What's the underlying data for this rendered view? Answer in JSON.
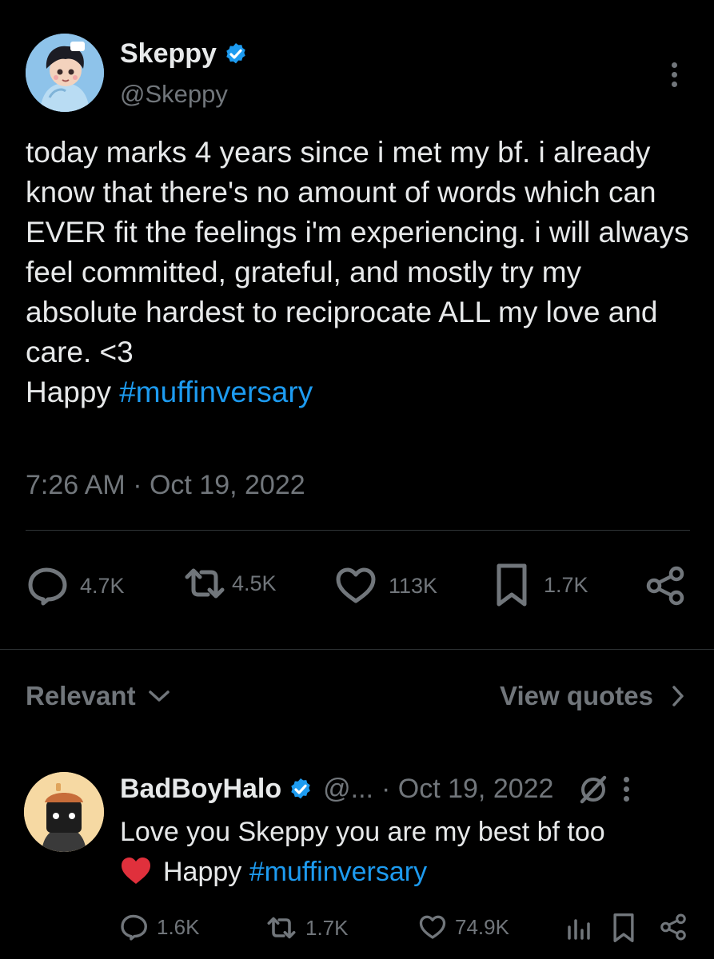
{
  "tweet": {
    "author_name": "Skeppy",
    "author_handle": "@Skeppy",
    "verified_icon": "verified-badge-icon",
    "text": "today marks 4 years since i met my bf. i already know that there's no amount of words which can EVER fit the feelings i'm experiencing. i will always feel committed, grateful, and mostly try my absolute hardest to reciprocate ALL my love and care. <3",
    "text_prefix": "Happy ",
    "hashtag": "#muffinversary",
    "timestamp": "7:26 AM · Oct 19, 2022",
    "stats": {
      "replies": "4.7K",
      "retweets": "4.5K",
      "likes": "113K",
      "bookmarks": "1.7K"
    }
  },
  "replies_bar": {
    "sort_label": "Relevant",
    "view_quotes_label": "View quotes"
  },
  "reply": {
    "author_name": "BadBoyHalo",
    "author_handle": "@...",
    "date": "· Oct 19, 2022",
    "text": "Love you Skeppy you are my best bf too",
    "emoji": "❤️",
    "text_prefix": "Happy ",
    "hashtag": "#muffinversary",
    "stats": {
      "replies": "1.6K",
      "retweets": "1.7K",
      "likes": "74.9K"
    }
  },
  "colors": {
    "background": "#000000",
    "text": "#e7e9ea",
    "muted": "#71767b",
    "accent": "#1d9bf0",
    "divider": "#2f3336"
  }
}
